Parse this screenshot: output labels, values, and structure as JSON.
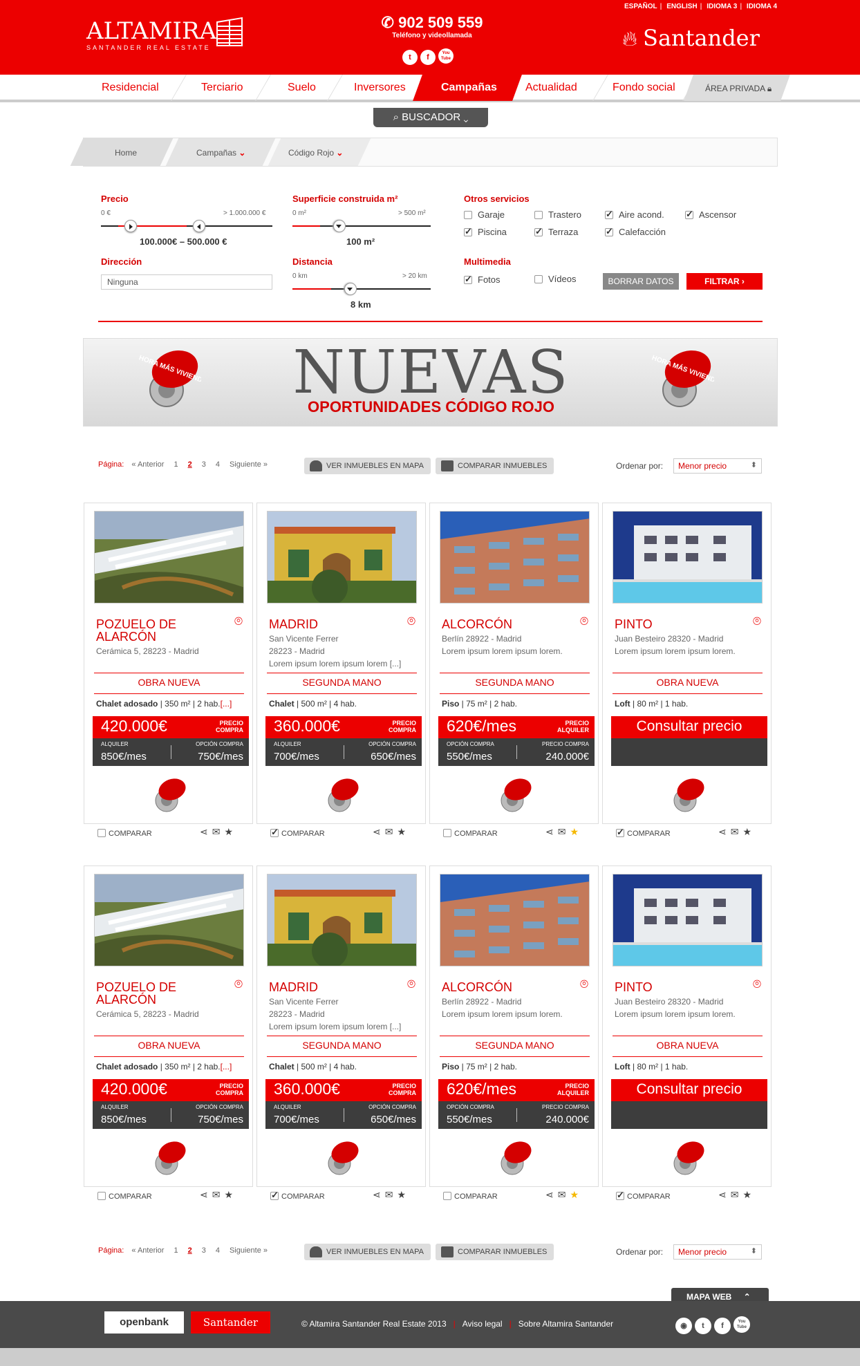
{
  "header": {
    "languages": [
      "ESPAÑOL",
      "ENGLISH",
      "IDIOMA 3",
      "IDIOMA 4"
    ],
    "logo_title": "ALTAMIRA",
    "logo_sub": "SANTANDER REAL ESTATE",
    "phone": "902 509 559",
    "phone_label": "Teléfono y videollamada",
    "social": [
      "t",
      "f",
      "You Tube"
    ],
    "brand": "Santander"
  },
  "nav": {
    "items": [
      "Residencial",
      "Terciario",
      "Suelo",
      "Inversores",
      "Campañas",
      "Actualidad",
      "Fondo social"
    ],
    "private": "ÁREA PRIVADA",
    "active": "Campañas"
  },
  "search_toggle": "BUSCADOR",
  "breadcrumb": [
    "Home",
    "Campañas",
    "Código Rojo"
  ],
  "filters": {
    "precio": {
      "label": "Precio",
      "min": "0 €",
      "max": "> 1.000.000 €",
      "value": "100.000€ – 500.000 €",
      "range": [
        0.1,
        0.5
      ]
    },
    "superficie": {
      "label": "Superficie construida m²",
      "min": "0 m²",
      "max": "> 500 m²",
      "value": "100 m²",
      "level": 0.2
    },
    "direccion": {
      "label": "Dirección",
      "value": "Ninguna"
    },
    "distancia": {
      "label": "Distancia",
      "min": "0 km",
      "max": "> 20 km",
      "value": "8 km",
      "level": 0.28
    },
    "otros": {
      "label": "Otros servicios",
      "options": [
        {
          "label": "Garaje",
          "checked": false
        },
        {
          "label": "Trastero",
          "checked": false
        },
        {
          "label": "Aire acond.",
          "checked": true
        },
        {
          "label": "Ascensor",
          "checked": true
        },
        {
          "label": "Piscina",
          "checked": true
        },
        {
          "label": "Terraza",
          "checked": true
        },
        {
          "label": "Calefacción",
          "checked": true
        }
      ]
    },
    "multimedia": {
      "label": "Multimedia",
      "options": [
        {
          "label": "Fotos",
          "checked": true
        },
        {
          "label": "Vídeos",
          "checked": false
        }
      ]
    },
    "borrar": "BORRAR DATOS",
    "filtrar": "FILTRAR"
  },
  "banner": {
    "title": "NUEVAS",
    "subtitle": "OPORTUNIDADES CÓDIGO ROJO",
    "seal": "AHORA MÁS VIVIENDAS"
  },
  "toolbar": {
    "page_label": "Página:",
    "prev": "« Anterior",
    "pages": [
      "1",
      "2",
      "3",
      "4"
    ],
    "current": "2",
    "next": "Siguiente »",
    "map_button": "VER INMUEBLES EN MAPA",
    "compare_button": "COMPARAR INMUEBLES",
    "order_label": "Ordenar por:",
    "order_value": "Menor precio"
  },
  "listings": [
    {
      "city": "POZUELO DE ALARCÓN",
      "addr": [
        "Cerámica 5, 28223 - Madrid"
      ],
      "type": "OBRA NUEVA",
      "feat_type": "Chalet adosado",
      "feat_rest": " | 350 m² | 2 hab.",
      "feat_more": "[...]",
      "price": "420.000€",
      "price_kind": "PRECIO COMPRA",
      "alt1_label": "ALQUILER",
      "alt1": "850€/mes",
      "alt2_label": "OPCIÓN COMPRA",
      "alt2": "750€/mes",
      "compare": false,
      "fav": false,
      "photo": "hill"
    },
    {
      "city": "MADRID",
      "addr": [
        "San Vicente Ferrer",
        "28223 - Madrid",
        "Lorem ipsum lorem ipsum lorem [...]"
      ],
      "type": "SEGUNDA MANO",
      "feat_type": "Chalet",
      "feat_rest": " | 500 m² | 4 hab.",
      "feat_more": "",
      "price": "360.000€",
      "price_kind": "PRECIO COMPRA",
      "alt1_label": "ALQUILER",
      "alt1": "700€/mes",
      "alt2_label": "OPCIÓN COMPRA",
      "alt2": "650€/mes",
      "compare": true,
      "fav": false,
      "photo": "house"
    },
    {
      "city": "ALCORCÓN",
      "addr": [
        "Berlín 28922 - Madrid",
        "Lorem ipsum lorem ipsum lorem."
      ],
      "type": "SEGUNDA MANO",
      "feat_type": "Piso",
      "feat_rest": " | 75 m² | 2 hab.",
      "feat_more": "",
      "price": "620€/mes",
      "price_kind": "PRECIO ALQUILER",
      "alt1_label": "OPCIÓN COMPRA",
      "alt1": "550€/mes",
      "alt2_label": "PRECIO COMPRA",
      "alt2": "240.000€",
      "compare": false,
      "fav": true,
      "photo": "block"
    },
    {
      "city": "PINTO",
      "addr": [
        "Juan Besteiro 28320 - Madrid",
        "Lorem ipsum lorem ipsum lorem."
      ],
      "type": "OBRA NUEVA",
      "feat_type": "Loft",
      "feat_rest": " | 80 m² | 1 hab.",
      "feat_more": "",
      "price": "Consultar precio",
      "price_kind": "",
      "alt1_label": "",
      "alt1": "",
      "alt2_label": "",
      "alt2": "",
      "compare": true,
      "fav": false,
      "photo": "pool"
    }
  ],
  "compare_label": "COMPARAR",
  "footer": {
    "map": "MAPA WEB",
    "openbank": "openbank",
    "santander": "Santander",
    "copyright": "© Altamira Santander Real Estate 2013",
    "links": [
      "Aviso legal",
      "Sobre Altamira Santander"
    ]
  }
}
